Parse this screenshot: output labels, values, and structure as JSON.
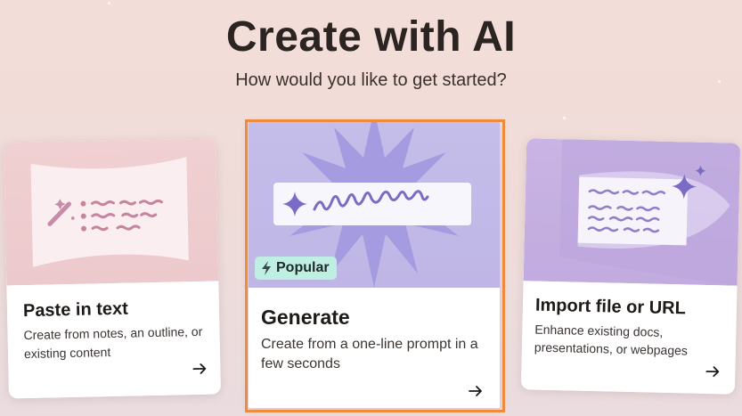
{
  "header": {
    "title": "Create with AI",
    "subtitle": "How would you like to get started?"
  },
  "cards": [
    {
      "title": "Paste in text",
      "description": "Create from notes, an outline, or existing content",
      "icon": "magic-wand-icon"
    },
    {
      "title": "Generate",
      "description": "Create from a one-line prompt in a few seconds",
      "badge": "Popular",
      "badge_icon": "lightning-icon",
      "selected": true
    },
    {
      "title": "Import file or URL",
      "description": "Enhance existing docs, presentations, or webpages",
      "icon": "sparkle-icon"
    }
  ],
  "colors": {
    "background": "#efdcd8",
    "focus_outline": "#f08a3c",
    "badge_bg": "#bfeee2",
    "generate_art": "#c4bde9",
    "paste_art": "#f0d0d2",
    "import_art": "#c9b4e4",
    "accent_purple": "#7a6bc4"
  }
}
